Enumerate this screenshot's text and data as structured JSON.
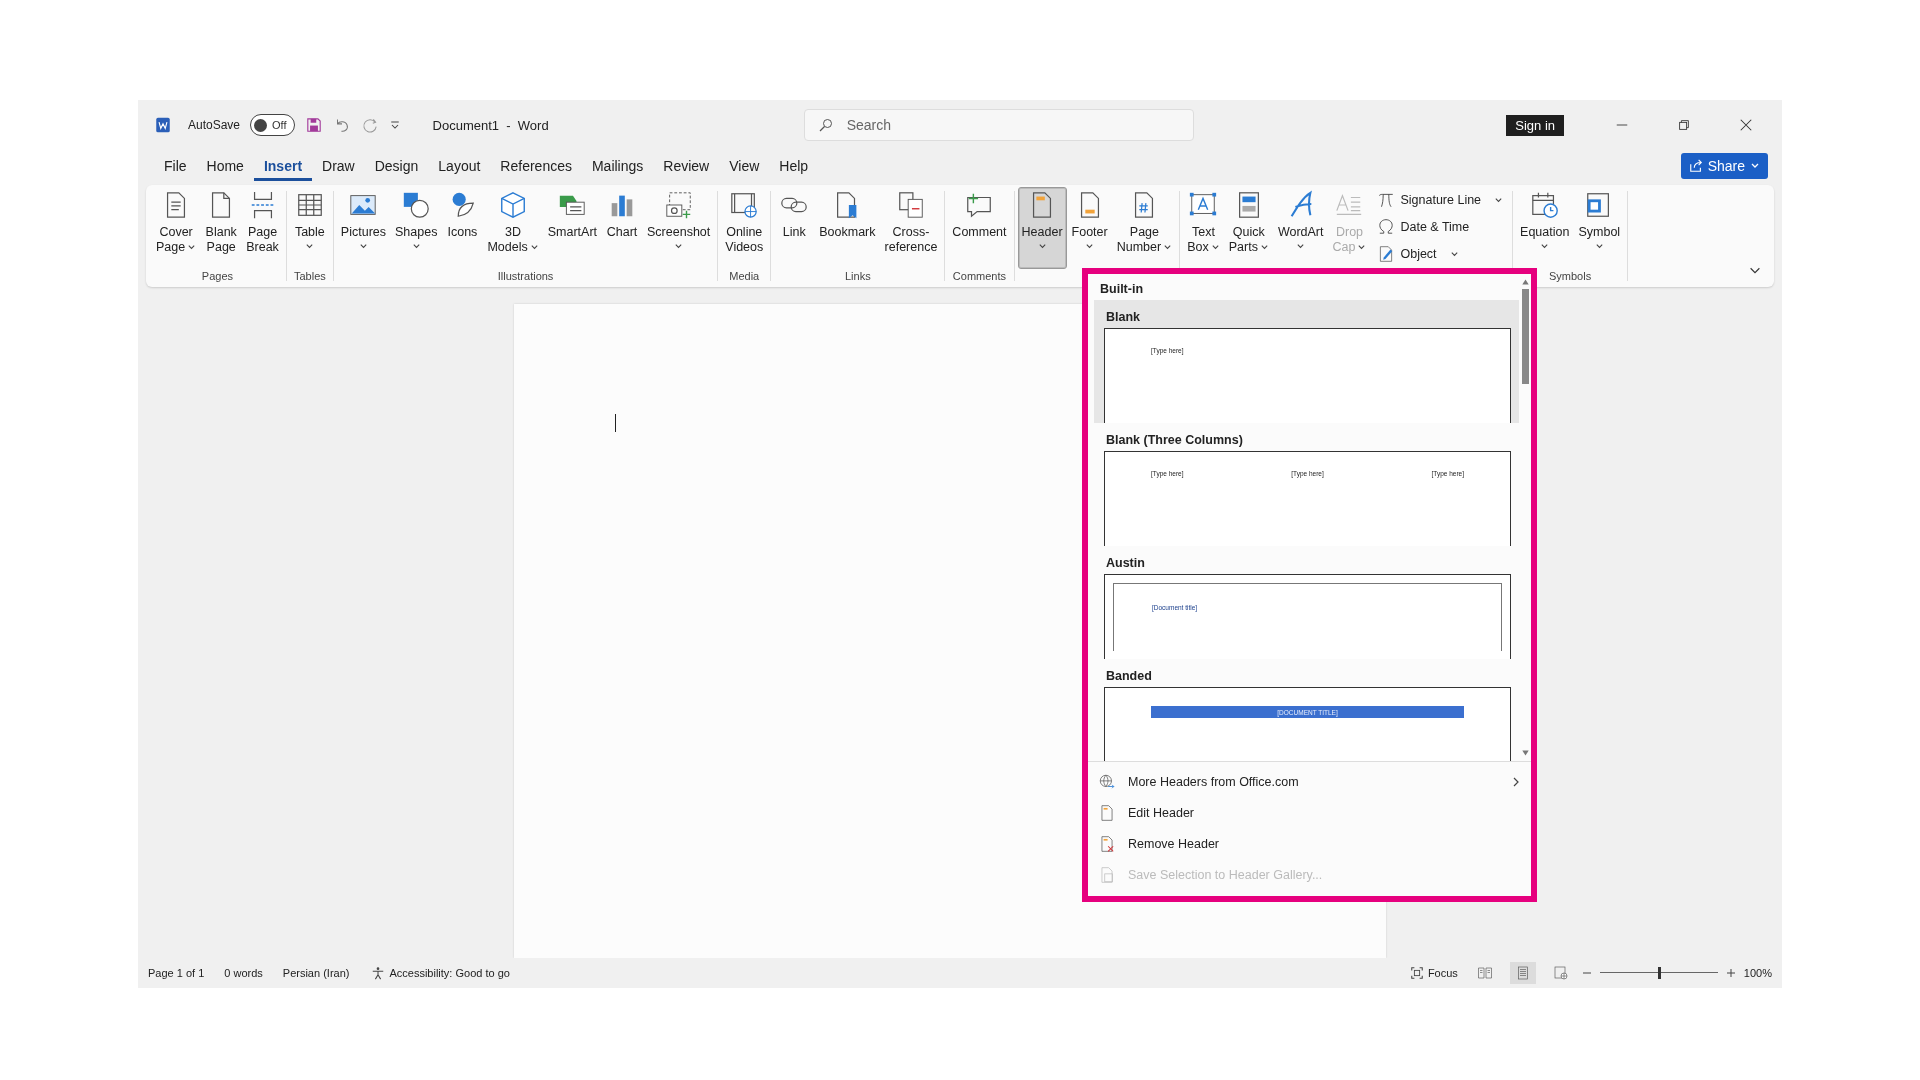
{
  "title_bar": {
    "autosave": {
      "label": "AutoSave",
      "on": false,
      "state_text": "Off"
    },
    "document_title": "Document1  -  Word",
    "search": {
      "placeholder": "Search"
    },
    "sign_in": "Sign in"
  },
  "menu_tabs": [
    {
      "label": "File",
      "selected": false
    },
    {
      "label": "Home",
      "selected": false
    },
    {
      "label": "Insert",
      "selected": true
    },
    {
      "label": "Draw",
      "selected": false
    },
    {
      "label": "Design",
      "selected": false
    },
    {
      "label": "Layout",
      "selected": false
    },
    {
      "label": "References",
      "selected": false
    },
    {
      "label": "Mailings",
      "selected": false
    },
    {
      "label": "Review",
      "selected": false
    },
    {
      "label": "View",
      "selected": false
    },
    {
      "label": "Help",
      "selected": false
    }
  ],
  "share": "Share",
  "ribbon_groups": [
    {
      "label": "Pages",
      "items": [
        {
          "kind": "large",
          "lines": [
            "Cover",
            "Page"
          ],
          "dropdown": true,
          "pressed": false,
          "disabled": false
        },
        {
          "kind": "large",
          "lines": [
            "Blank",
            "Page"
          ],
          "dropdown": false,
          "pressed": false,
          "disabled": false
        },
        {
          "kind": "large",
          "lines": [
            "Page",
            "Break"
          ],
          "dropdown": false,
          "pressed": false,
          "disabled": false
        }
      ]
    },
    {
      "label": "Tables",
      "items": [
        {
          "kind": "large",
          "lines": [
            "Table"
          ],
          "dropdown": true,
          "pressed": false,
          "disabled": false
        }
      ]
    },
    {
      "label": "Illustrations",
      "items": [
        {
          "kind": "large",
          "lines": [
            "Pictures"
          ],
          "dropdown": true,
          "pressed": false,
          "disabled": false
        },
        {
          "kind": "large",
          "lines": [
            "Shapes"
          ],
          "dropdown": true,
          "pressed": false,
          "disabled": false
        },
        {
          "kind": "large",
          "lines": [
            "Icons"
          ],
          "dropdown": false,
          "pressed": false,
          "disabled": false
        },
        {
          "kind": "large",
          "lines": [
            "3D",
            "Models"
          ],
          "dropdown": true,
          "pressed": false,
          "disabled": false
        },
        {
          "kind": "large",
          "lines": [
            "SmartArt"
          ],
          "dropdown": false,
          "pressed": false,
          "disabled": false
        },
        {
          "kind": "large",
          "lines": [
            "Chart"
          ],
          "dropdown": false,
          "pressed": false,
          "disabled": false
        },
        {
          "kind": "large",
          "lines": [
            "Screenshot"
          ],
          "dropdown": true,
          "pressed": false,
          "disabled": false
        }
      ]
    },
    {
      "label": "Media",
      "items": [
        {
          "kind": "large",
          "lines": [
            "Online",
            "Videos"
          ],
          "dropdown": false,
          "pressed": false,
          "disabled": false
        }
      ]
    },
    {
      "label": "Links",
      "items": [
        {
          "kind": "large",
          "lines": [
            "Link"
          ],
          "dropdown": false,
          "pressed": false,
          "disabled": false
        },
        {
          "kind": "large",
          "lines": [
            "Bookmark"
          ],
          "dropdown": false,
          "pressed": false,
          "disabled": false
        },
        {
          "kind": "large",
          "lines": [
            "Cross-",
            "reference"
          ],
          "dropdown": false,
          "pressed": false,
          "disabled": false
        }
      ]
    },
    {
      "label": "Comments",
      "items": [
        {
          "kind": "large",
          "lines": [
            "Comment"
          ],
          "dropdown": false,
          "pressed": false,
          "disabled": false
        }
      ]
    },
    {
      "items": [
        {
          "kind": "large",
          "lines": [
            "Header"
          ],
          "dropdown": true,
          "pressed": true,
          "disabled": false
        },
        {
          "kind": "large",
          "lines": [
            "Footer"
          ],
          "dropdown": true,
          "pressed": false,
          "disabled": false
        },
        {
          "kind": "large",
          "lines": [
            "Page",
            "Number"
          ],
          "dropdown": true,
          "pressed": false,
          "disabled": false
        }
      ]
    },
    {
      "items": [
        {
          "kind": "large",
          "lines": [
            "Text",
            "Box"
          ],
          "dropdown": true,
          "pressed": false,
          "disabled": false
        },
        {
          "kind": "large",
          "lines": [
            "Quick",
            "Parts"
          ],
          "dropdown": true,
          "pressed": false,
          "disabled": false
        },
        {
          "kind": "large",
          "lines": [
            "WordArt"
          ],
          "dropdown": true,
          "pressed": false,
          "disabled": false
        },
        {
          "kind": "large",
          "lines": [
            "Drop",
            "Cap"
          ],
          "dropdown": true,
          "pressed": false,
          "disabled": true
        },
        {
          "kind": "small",
          "lines": [
            "Signature Line"
          ],
          "dropdown": true,
          "disabled": false
        },
        {
          "kind": "small",
          "lines": [
            "Date & Time"
          ],
          "dropdown": false,
          "disabled": false
        },
        {
          "kind": "small",
          "lines": [
            "Object"
          ],
          "dropdown": true,
          "disabled": false
        }
      ]
    },
    {
      "label": "Symbols",
      "items": [
        {
          "kind": "large",
          "lines": [
            "Equation"
          ],
          "dropdown": true,
          "pressed": false,
          "disabled": false
        },
        {
          "kind": "large",
          "lines": [
            "Symbol"
          ],
          "dropdown": true,
          "pressed": false,
          "disabled": false
        }
      ]
    }
  ],
  "header_menu": {
    "section": "Built-in",
    "gallery": [
      {
        "title": "Blank",
        "kind": "single",
        "highlighted": true,
        "placeholders": [
          "[Type here]"
        ]
      },
      {
        "title": "Blank (Three Columns)",
        "kind": "three",
        "highlighted": false,
        "placeholders": [
          "[Type here]",
          "[Type here]",
          "[Type here]"
        ]
      },
      {
        "title": "Austin",
        "kind": "framed",
        "highlighted": false,
        "placeholders": [
          "[Document title]"
        ]
      },
      {
        "title": "Banded",
        "kind": "band",
        "highlighted": false,
        "placeholders": [
          "[DOCUMENT TITLE]"
        ]
      }
    ],
    "actions": [
      {
        "label": "More Headers from Office.com",
        "submenu": true,
        "disabled": false
      },
      {
        "label": "Edit Header",
        "submenu": false,
        "disabled": false
      },
      {
        "label": "Remove Header",
        "submenu": false,
        "disabled": false
      },
      {
        "label": "Save Selection to Header Gallery...",
        "submenu": false,
        "disabled": true
      }
    ]
  },
  "status_bar": {
    "left": [
      "Page 1 of 1",
      "0 words",
      "Persian (Iran)"
    ],
    "accessibility": "Accessibility: Good to go",
    "focus": "Focus",
    "views": [
      {
        "selected": false
      },
      {
        "selected": true
      },
      {
        "selected": false
      }
    ],
    "zoom": {
      "level": 0.5,
      "reading": "100%"
    }
  }
}
